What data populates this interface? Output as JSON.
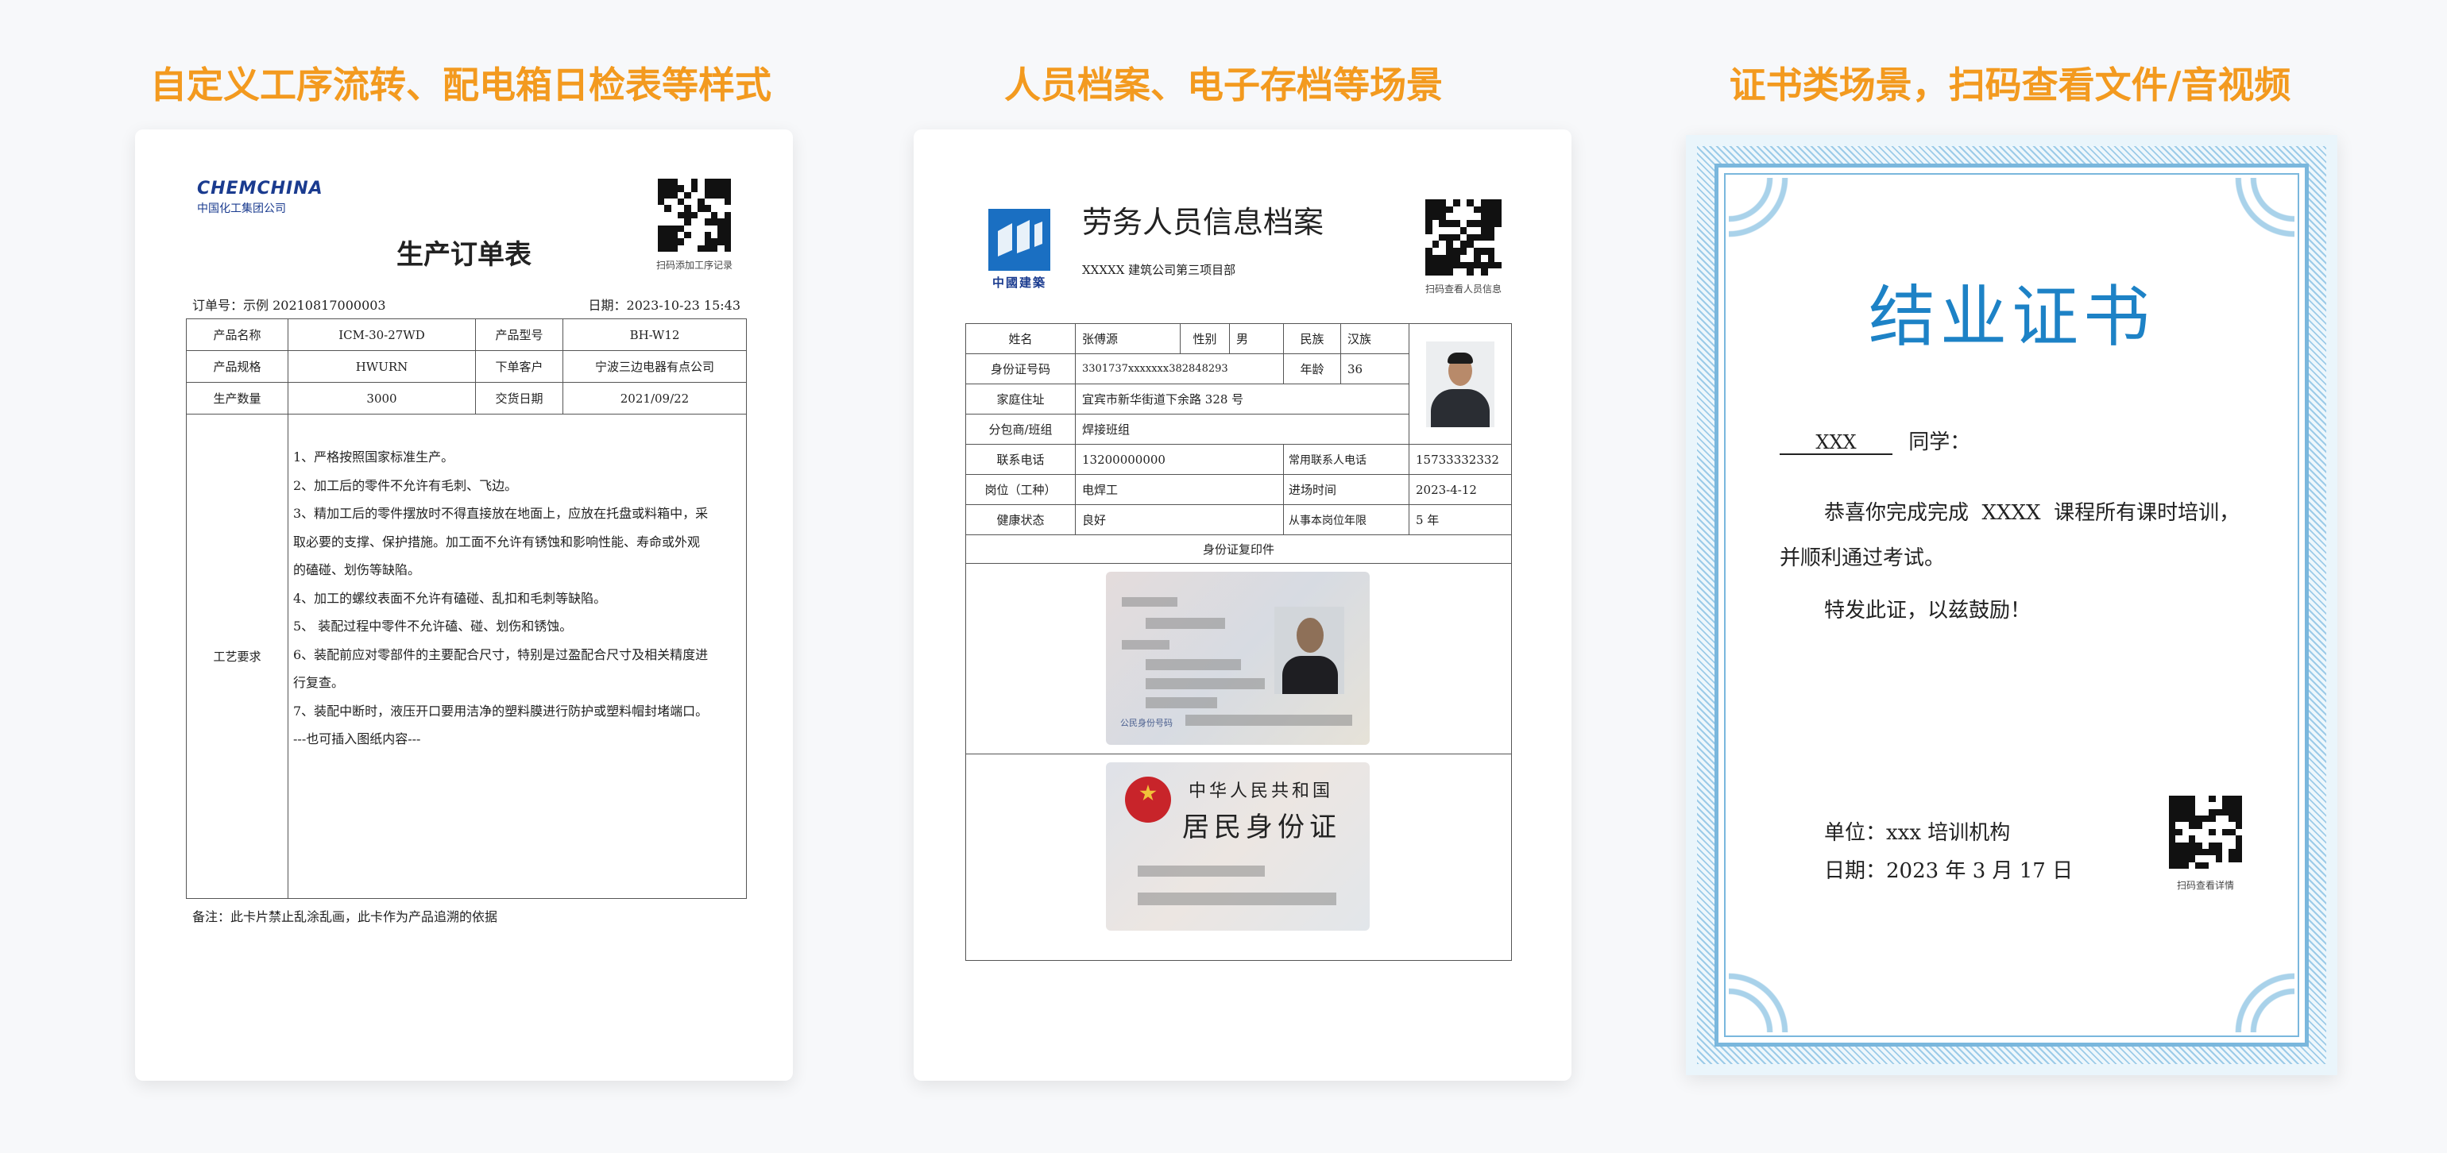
{
  "headings": {
    "h1": "自定义工序流转、配电箱日检表等样式",
    "h2": "人员档案、电子存档等场景",
    "h3": "证书类场景，扫码查看文件/音视频"
  },
  "card1": {
    "logo_en": "CHEMCHINA",
    "logo_cn": "中国化工集团公司",
    "qr_caption": "扫码添加工序记录",
    "title": "生产订单表",
    "order_no": "订单号：示例 20210817000003",
    "date": "日期：2023-10-23 15:43",
    "rows": [
      [
        "产品名称",
        "ICM-30-27WD",
        "产品型号",
        "BH-W12"
      ],
      [
        "产品规格",
        "HWURN",
        "下单客户",
        "宁波三边电器有点公司"
      ],
      [
        "生产数量",
        "3000",
        "交货日期",
        "2021/09/22"
      ]
    ],
    "process_label": "工艺要求",
    "process_lines": [
      "1、严格按照国家标准生产。",
      "2、加工后的零件不允许有毛刺、飞边。",
      "3、精加工后的零件摆放时不得直接放在地面上，应放在托盘或料箱中，采",
      "取必要的支撑、保护措施。加工面不允许有锈蚀和影响性能、寿命或外观",
      "的磕碰、划伤等缺陷。",
      "4、加工的螺纹表面不允许有磕碰、乱扣和毛刺等缺陷。",
      "5、 装配过程中零件不允许磕、碰、划伤和锈蚀。",
      "6、装配前应对零部件的主要配合尺寸，特别是过盈配合尺寸及相关精度进",
      "行复查。",
      "7、装配中断时，液压开口要用洁净的塑料膜进行防护或塑料帽封堵端口。",
      "---也可插入图纸内容---"
    ],
    "footnote": "备注：此卡片禁止乱涂乱画，此卡作为产品追溯的依据"
  },
  "card2": {
    "logo_cn": "中國建築",
    "title": "劳务人员信息档案",
    "subtitle": "XXXXX 建筑公司第三项目部",
    "qr_caption": "扫码查看人员信息",
    "name_label": "姓名",
    "name": "张傅源",
    "gender_label": "性别",
    "gender": "男",
    "ethnic_label": "民族",
    "ethnic": "汉族",
    "id_label": "身份证号码",
    "id": "3301737xxxxxxx3828482​93",
    "age_label": "年龄",
    "age": "36",
    "address_label": "家庭住址",
    "address": "宜宾市新华街道下余路 328 号",
    "team_label": "分包商/班组",
    "team": "焊接班组",
    "phone_label": "联系电话",
    "phone": "13200000000",
    "contact_label": "常用联系人电话",
    "contact": "15733332332",
    "job_label": "岗位（工种）",
    "job": "电焊工",
    "entry_label": "进场时间",
    "entry": "2023-4-12",
    "health_label": "健康状态",
    "health": "良好",
    "years_label": "从事本岗位年限",
    "years": "5 年",
    "copy_label": "身份证复印件",
    "idcard_back_line1": "中华人民共和国",
    "idcard_back_line2": "居民身份证",
    "idcard_front_label": "公民身份号码"
  },
  "card3": {
    "title": "结业证书",
    "name_placeholder": "XXX",
    "greeting_suffix": "同学：",
    "body_line1": "恭喜你完成完成  XXXX  课程所有课时培训，",
    "body_line2": "并顺利通过考试。",
    "body_line3": "特发此证，以兹鼓励！",
    "org": "单位：xxx 培训机构",
    "date": "日期：2023 年 3 月 17 日",
    "qr_caption": "扫码查看详情"
  }
}
